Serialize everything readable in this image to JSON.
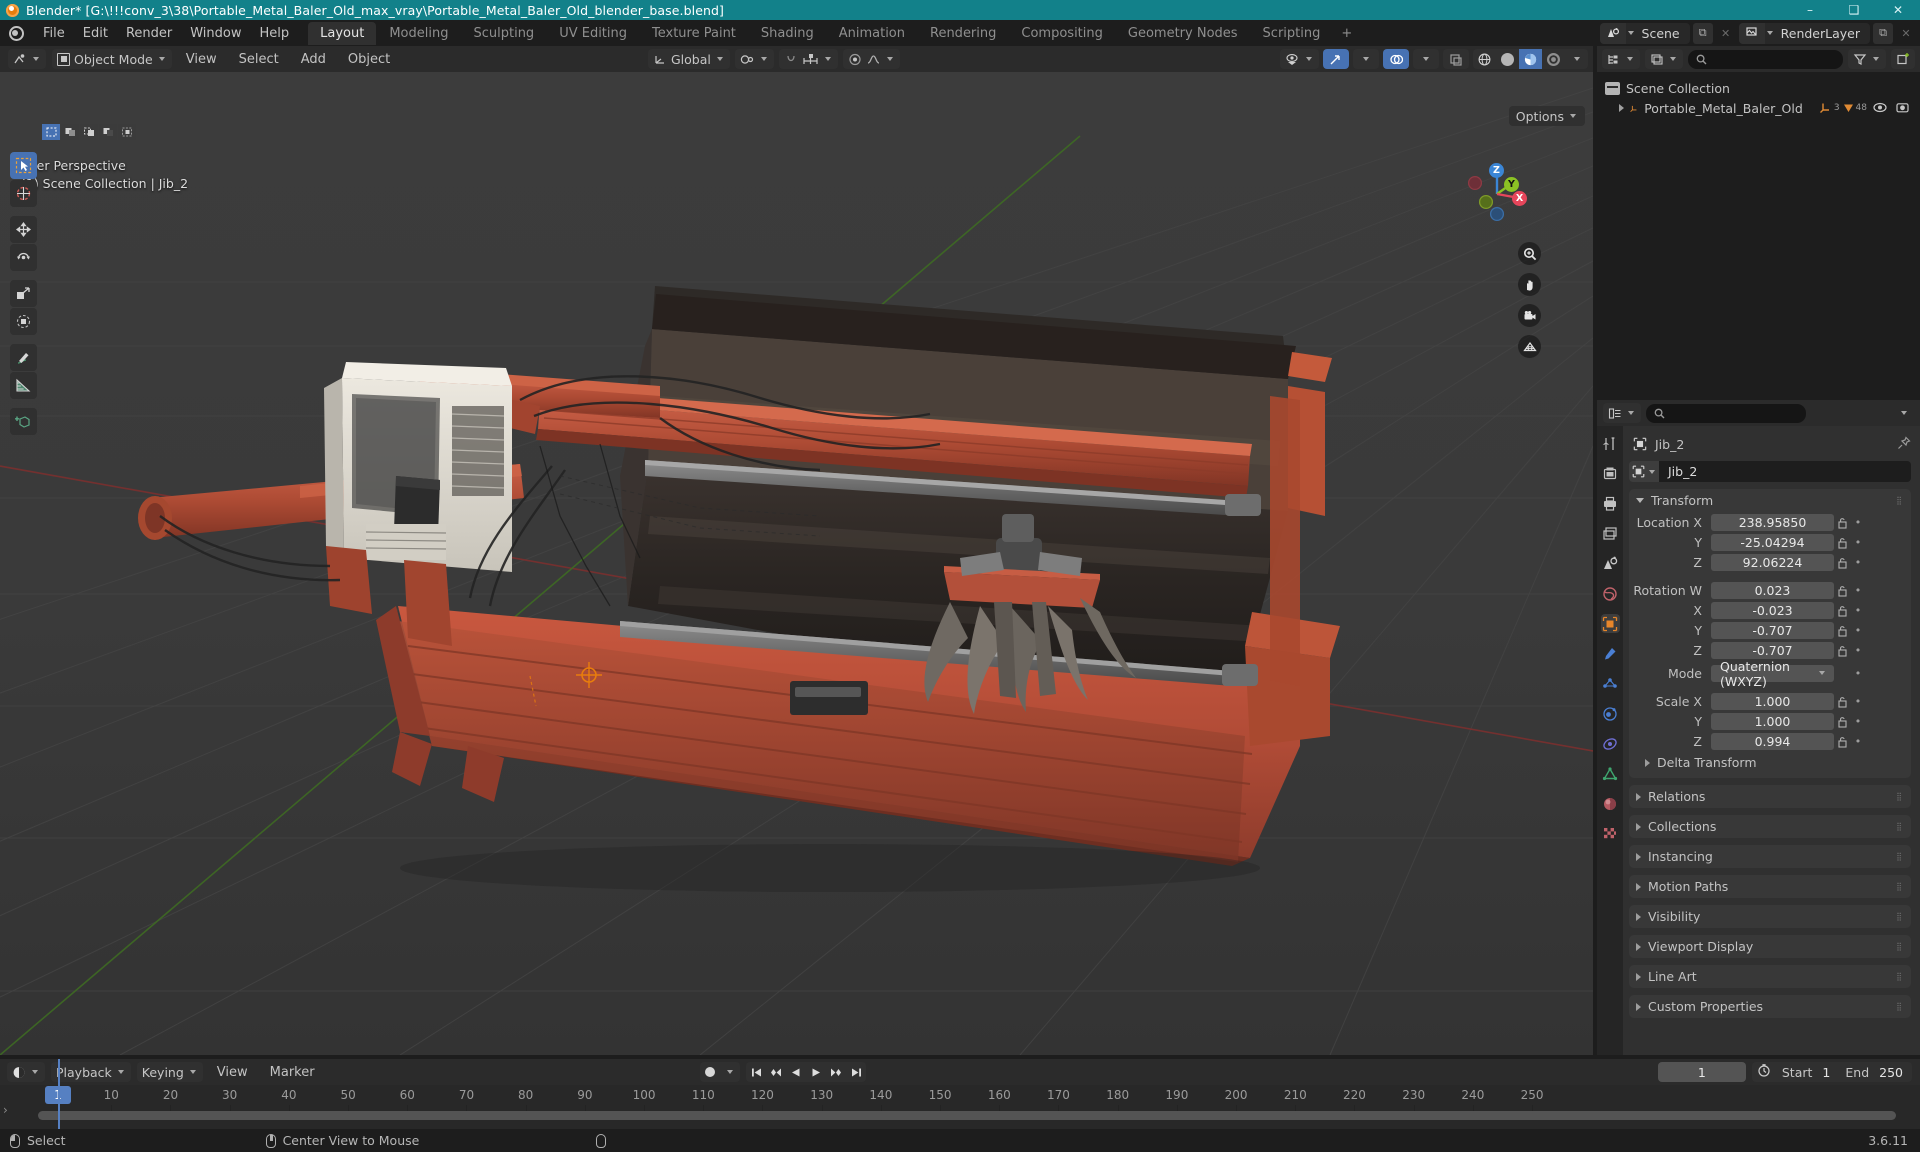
{
  "titlebar": {
    "title": "Blender* [G:\\!!!conv_3\\38\\Portable_Metal_Baler_Old_max_vray\\Portable_Metal_Baler_Old_blender_base.blend]",
    "minimize": "–",
    "maximize": "❑",
    "close": "✕"
  },
  "menubar": {
    "items": [
      "File",
      "Edit",
      "Render",
      "Window",
      "Help"
    ],
    "workspaces": [
      {
        "label": "Layout",
        "active": true
      },
      {
        "label": "Modeling",
        "active": false
      },
      {
        "label": "Sculpting",
        "active": false
      },
      {
        "label": "UV Editing",
        "active": false
      },
      {
        "label": "Texture Paint",
        "active": false
      },
      {
        "label": "Shading",
        "active": false
      },
      {
        "label": "Animation",
        "active": false
      },
      {
        "label": "Rendering",
        "active": false
      },
      {
        "label": "Compositing",
        "active": false
      },
      {
        "label": "Geometry Nodes",
        "active": false
      },
      {
        "label": "Scripting",
        "active": false
      },
      {
        "label": "+",
        "active": false
      }
    ],
    "scene_name": "Scene",
    "viewlayer_name": "RenderLayer"
  },
  "viewport_header": {
    "mode": "Object Mode",
    "menus": [
      "View",
      "Select",
      "Add",
      "Object"
    ],
    "transform_orientation": "Global",
    "options_label": "Options"
  },
  "viewport": {
    "perspective_label": "User Perspective",
    "collection_label": "(1) Scene Collection | Jib_2",
    "gizmo_axes": [
      {
        "label": "Z",
        "color": "#3b86d6"
      },
      {
        "label": "Y",
        "color": "#8bc224"
      },
      {
        "label": "X",
        "color": "#e6465b"
      }
    ],
    "nav_icons": [
      "zoom-icon",
      "hand-icon",
      "camera-icon",
      "grid-icon"
    ]
  },
  "outliner": {
    "search_placeholder": "",
    "rows": [
      {
        "label": "Scene Collection",
        "indent": 0,
        "icon": "collection-icon"
      },
      {
        "label": "Portable_Metal_Baler_Old",
        "indent": 1,
        "icon": "empty-axis-icon",
        "badge_mesh": "3",
        "badge_mod": "48"
      }
    ]
  },
  "properties": {
    "breadcrumb_object": "Jib_2",
    "object_name": "Jib_2",
    "transform": {
      "title": "Transform",
      "rows": [
        {
          "label": "Location X",
          "value": "238.95850",
          "lock": true
        },
        {
          "label": "Y",
          "value": "-25.04294",
          "lock": true
        },
        {
          "label": "Z",
          "value": "92.06224",
          "lock": true
        }
      ],
      "rotation": [
        {
          "label": "Rotation W",
          "value": "0.023",
          "lock": true
        },
        {
          "label": "X",
          "value": "-0.023",
          "lock": true
        },
        {
          "label": "Y",
          "value": "-0.707",
          "lock": true
        },
        {
          "label": "Z",
          "value": "-0.707",
          "lock": true
        }
      ],
      "mode_label": "Mode",
      "mode_value": "Quaternion (WXYZ)",
      "scale": [
        {
          "label": "Scale X",
          "value": "1.000",
          "lock": true
        },
        {
          "label": "Y",
          "value": "1.000",
          "lock": true
        },
        {
          "label": "Z",
          "value": "0.994",
          "lock": true
        }
      ],
      "delta_label": "Delta Transform"
    },
    "panels": [
      "Relations",
      "Collections",
      "Instancing",
      "Motion Paths",
      "Visibility",
      "Viewport Display",
      "Line Art",
      "Custom Properties"
    ],
    "tabs": [
      "tool-icon",
      "render-icon",
      "output-icon",
      "viewlayer-icon",
      "scene-icon",
      "world-icon",
      "object-icon",
      "modifier-icon",
      "particles-icon",
      "physics-icon",
      "constraints-icon",
      "data-icon",
      "material-icon",
      "texture-icon"
    ]
  },
  "timeline": {
    "menus": [
      "Playback",
      "Keying",
      "View",
      "Marker"
    ],
    "current_frame": "1",
    "start_label": "Start",
    "start_value": "1",
    "end_label": "End",
    "end_value": "250",
    "ticks": [
      10,
      20,
      30,
      40,
      50,
      60,
      70,
      80,
      90,
      100,
      110,
      120,
      130,
      140,
      150,
      160,
      170,
      180,
      190,
      200,
      210,
      220,
      230,
      240,
      250
    ],
    "playhead_label": "1",
    "transport": [
      "jump-start-icon",
      "prev-keyframe-icon",
      "play-reverse-icon",
      "play-icon",
      "next-keyframe-icon",
      "jump-end-icon"
    ]
  },
  "statusbar": {
    "left_action": "Select",
    "mid_action": "Center View to Mouse",
    "version": "3.6.11"
  },
  "colors": {
    "title_bar": "#12818a",
    "accent_blue": "#4772b3",
    "panel_bg": "#303030",
    "editor_bg": "#1d1d1d",
    "viewport_bg": "#393939",
    "orange": "#e87d0d"
  }
}
